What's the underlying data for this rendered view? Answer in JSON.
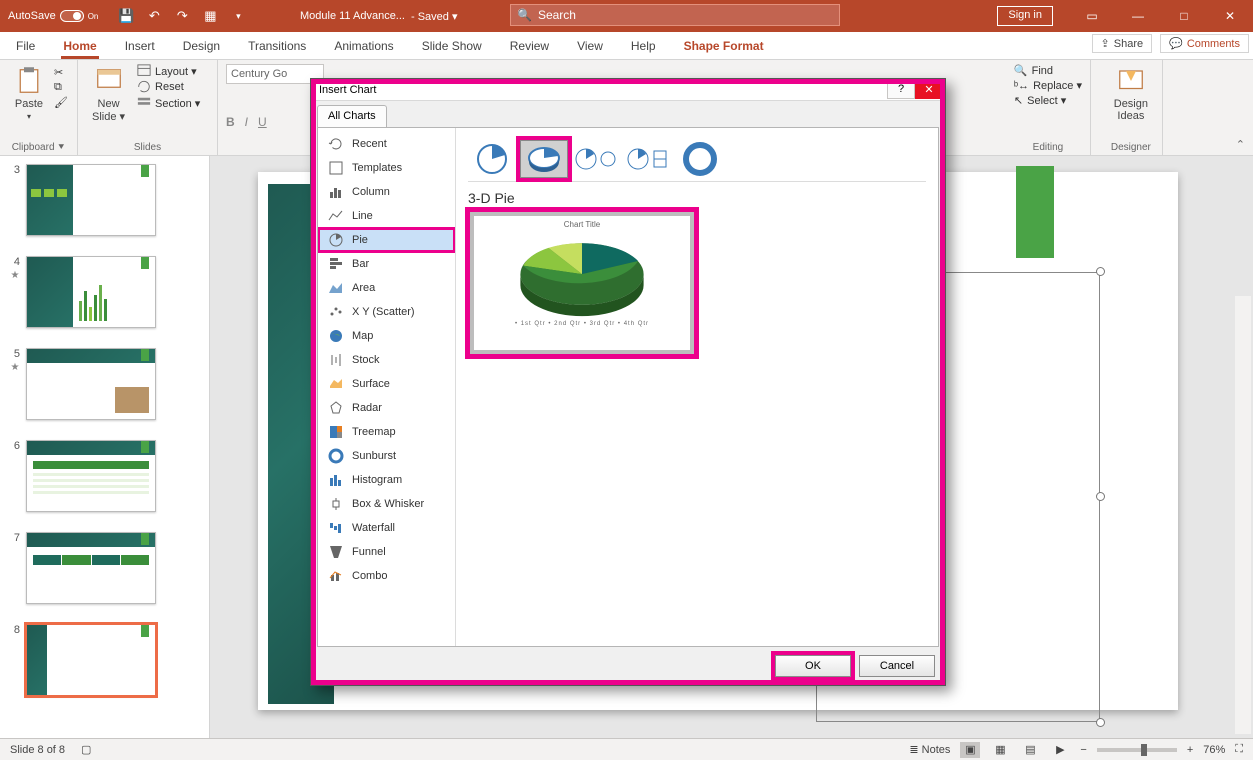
{
  "titlebar": {
    "autosave": "AutoSave",
    "autosave_state": "On",
    "doc": "Module 11 Advance...",
    "saved": "- Saved ▾",
    "search": "Search",
    "signin": "Sign in"
  },
  "ribbon_tabs": [
    "File",
    "Home",
    "Insert",
    "Design",
    "Transitions",
    "Animations",
    "Slide Show",
    "Review",
    "View",
    "Help",
    "Shape Format"
  ],
  "ribbon": {
    "paste": "Paste",
    "clipboard": "Clipboard",
    "newslide": "New\nSlide ▾",
    "slides": "Slides",
    "layout": "Layout ▾",
    "reset": "Reset",
    "section": "Section ▾",
    "font": "Century Go",
    "find": "Find",
    "replace": "Replace ▾",
    "select": "Select ▾",
    "editing": "Editing",
    "design_ideas": "Design\nIdeas",
    "designer": "Designer",
    "share": "Share",
    "comments": "Comments"
  },
  "thumbs": [
    {
      "n": "3"
    },
    {
      "n": "4",
      "star": true
    },
    {
      "n": "5",
      "star": true
    },
    {
      "n": "6"
    },
    {
      "n": "7"
    },
    {
      "n": "8",
      "sel": true
    }
  ],
  "dialog": {
    "title": "Insert Chart",
    "tab": "All Charts",
    "categories": [
      "Recent",
      "Templates",
      "Column",
      "Line",
      "Pie",
      "Bar",
      "Area",
      "X Y (Scatter)",
      "Map",
      "Stock",
      "Surface",
      "Radar",
      "Treemap",
      "Sunburst",
      "Histogram",
      "Box & Whisker",
      "Waterfall",
      "Funnel",
      "Combo"
    ],
    "selected_category": "Pie",
    "subtype_title": "3-D Pie",
    "preview_title": "Chart Title",
    "preview_legend": "• 1st Qtr   • 2nd Qtr   • 3rd Qtr   • 4th Qtr",
    "ok": "OK",
    "cancel": "Cancel",
    "help": "?",
    "close": "✕"
  },
  "status": {
    "slide": "Slide 8 of 8",
    "notes": "Notes",
    "zoom": "76%"
  },
  "chart_data": {
    "type": "pie",
    "title": "Chart Title",
    "categories": [
      "1st Qtr",
      "2nd Qtr",
      "3rd Qtr",
      "4th Qtr"
    ],
    "values": [
      58,
      23,
      10,
      9
    ],
    "colors": [
      "#3b8e3b",
      "#8cc63f",
      "#c5de5f",
      "#0f6a60"
    ]
  }
}
